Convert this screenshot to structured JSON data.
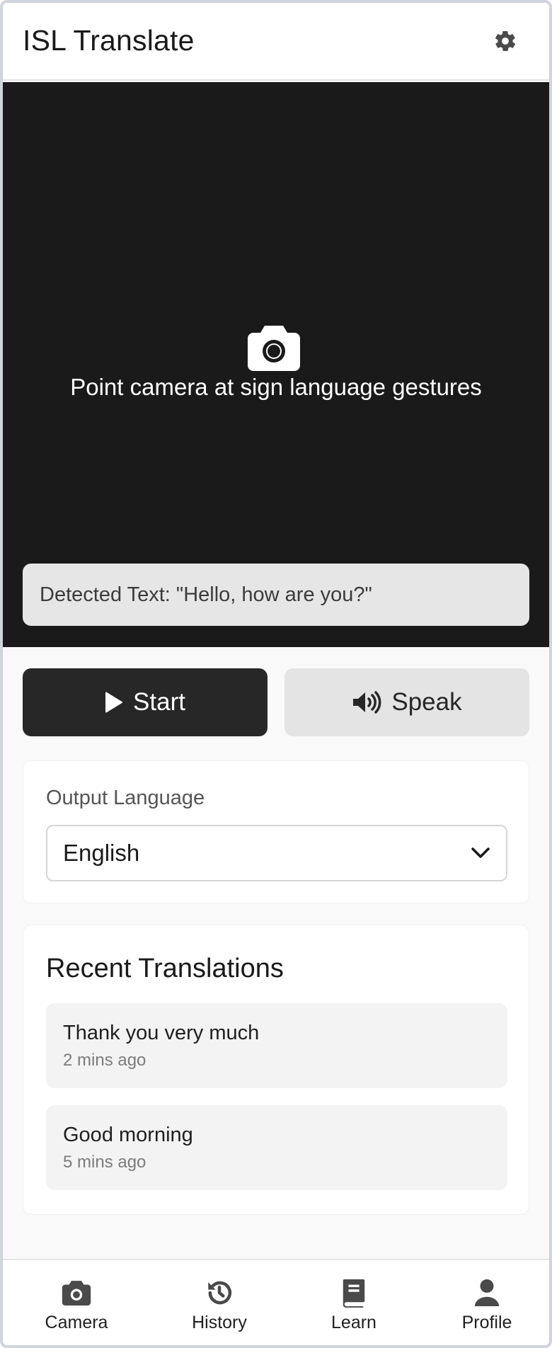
{
  "header": {
    "title": "ISL Translate",
    "settings_icon": "gear-icon"
  },
  "camera": {
    "icon": "camera-icon",
    "hint": "Point camera at sign language gestures",
    "detected_text": "Detected Text: \"Hello, how are you?\""
  },
  "actions": {
    "start_label": "Start",
    "start_icon": "play-icon",
    "speak_label": "Speak",
    "speak_icon": "speaker-icon"
  },
  "output_language": {
    "label": "Output Language",
    "selected": "English"
  },
  "recent": {
    "title": "Recent Translations",
    "items": [
      {
        "text": "Thank you very much",
        "time": "2 mins ago"
      },
      {
        "text": "Good morning",
        "time": "5 mins ago"
      }
    ]
  },
  "nav": {
    "items": [
      {
        "label": "Camera",
        "icon": "camera-icon"
      },
      {
        "label": "History",
        "icon": "history-icon"
      },
      {
        "label": "Learn",
        "icon": "book-icon"
      },
      {
        "label": "Profile",
        "icon": "user-icon"
      }
    ]
  },
  "colors": {
    "primary_dark": "#272727",
    "camera_bg": "#1a1a1a",
    "page_bg": "#f9f9f9",
    "secondary_btn": "#e4e4e4"
  }
}
